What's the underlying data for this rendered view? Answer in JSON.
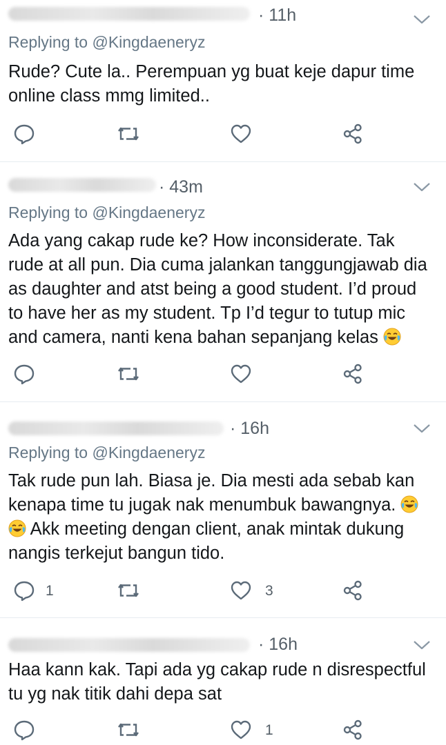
{
  "tweets": [
    {
      "time": "· 11h",
      "replying_prefix": "Replying to ",
      "replying_handle": "@Kingdaeneryz",
      "text": "Rude? Cute la.. Perempuan yg buat keje dapur time\nonline class mmg limited..",
      "reply_count": "",
      "like_count": ""
    },
    {
      "time": "· 43m",
      "replying_prefix": "Replying to ",
      "replying_handle": "@Kingdaeneryz",
      "text": "Ada yang cakap rude ke? How inconsiderate. Tak\nrude at all pun. Dia cuma jalankan tanggungjawab dia\nas daughter and atst being a good student. I’d proud\nto have her as my student. Tp I’d tegur to tutup mic\nand camera, nanti kena bahan sepanjang kelas",
      "reply_count": "",
      "like_count": ""
    },
    {
      "time": "· 16h",
      "replying_prefix": "Replying to ",
      "replying_handle": "@Kingdaeneryz",
      "text_line1": "Tak rude pun lah. Biasa je. Dia mesti ada sebab kan",
      "text_line2": "kenapa time tu jugak nak menumbuk bawangnya.",
      "text_line3": " Akk meeting dengan client, anak mintak dukung",
      "text_line4": "nangis terkejut bangun tido.",
      "reply_count": "1",
      "like_count": "3"
    },
    {
      "time": "· 16h",
      "text": "Haa kann kak. Tapi ada yg cakap rude n disrespectful\ntu yg nak titik dahi depa sat",
      "reply_count": "",
      "like_count": "1"
    }
  ],
  "icons": {
    "reply": "reply-icon",
    "retweet": "retweet-icon",
    "like": "like-icon",
    "share": "share-icon",
    "emoji": "face-with-tears-of-joy-emoji"
  },
  "colors": {
    "text": "#14171a",
    "muted": "#657786",
    "icon": "#5b6a78",
    "separator": "#e6ecf0"
  }
}
